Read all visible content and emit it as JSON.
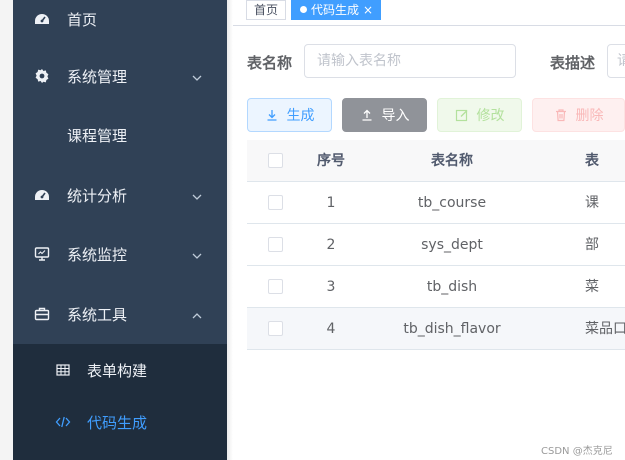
{
  "sidebar": {
    "items": [
      {
        "label": "首页",
        "icon": "dashboard-icon"
      },
      {
        "label": "系统管理",
        "icon": "gear-icon"
      },
      {
        "label": "课程管理"
      },
      {
        "label": "统计分析",
        "icon": "dashboard-icon"
      },
      {
        "label": "系统监控",
        "icon": "monitor-icon"
      },
      {
        "label": "系统工具",
        "icon": "toolbox-icon"
      }
    ],
    "submenu": [
      {
        "label": "表单构建",
        "icon": "table-icon"
      },
      {
        "label": "代码生成",
        "icon": "code-icon"
      }
    ]
  },
  "tags": {
    "home": "首页",
    "active": "代码生成",
    "close": "×"
  },
  "search": {
    "table_name_label": "表名称",
    "table_name_placeholder": "请输入表名称",
    "table_desc_label": "表描述",
    "table_desc_placeholder": "请"
  },
  "toolbar": {
    "generate": "生成",
    "import": "导入",
    "edit": "修改",
    "delete": "删除"
  },
  "table": {
    "headers": {
      "no": "序号",
      "name": "表名称",
      "desc": "表"
    },
    "rows": [
      {
        "no": "1",
        "name": "tb_course",
        "desc": "课"
      },
      {
        "no": "2",
        "name": "sys_dept",
        "desc": "部"
      },
      {
        "no": "3",
        "name": "tb_dish",
        "desc": "菜"
      },
      {
        "no": "4",
        "name": "tb_dish_flavor",
        "desc": "菜品口"
      }
    ]
  },
  "watermark": "CSDN @杰克尼",
  "colors": {
    "sidebar_bg": "#304156",
    "submenu_bg": "#1f2d3d",
    "accent": "#409eff"
  }
}
